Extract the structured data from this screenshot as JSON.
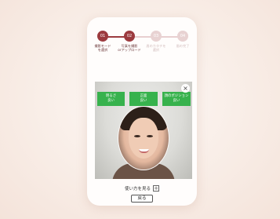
{
  "steps": [
    {
      "num": "01",
      "label": "撮影モード\nを選択"
    },
    {
      "num": "02",
      "label": "写真を撮影\norアップロード"
    },
    {
      "num": "03",
      "label": "眉のカタチを\n選択"
    },
    {
      "num": "04",
      "label": "眉の完了"
    }
  ],
  "guides": [
    {
      "label": "明るさ\n良い"
    },
    {
      "label": "正面\n良い"
    },
    {
      "label": "顔のポジション\n良い"
    }
  ],
  "close_symbol": "×",
  "howto": {
    "label": "使い方を見る",
    "icon": "+"
  },
  "back_label": "戻る",
  "colors": {
    "accent": "#9c3b3f",
    "guide_ok": "#37b24d"
  }
}
